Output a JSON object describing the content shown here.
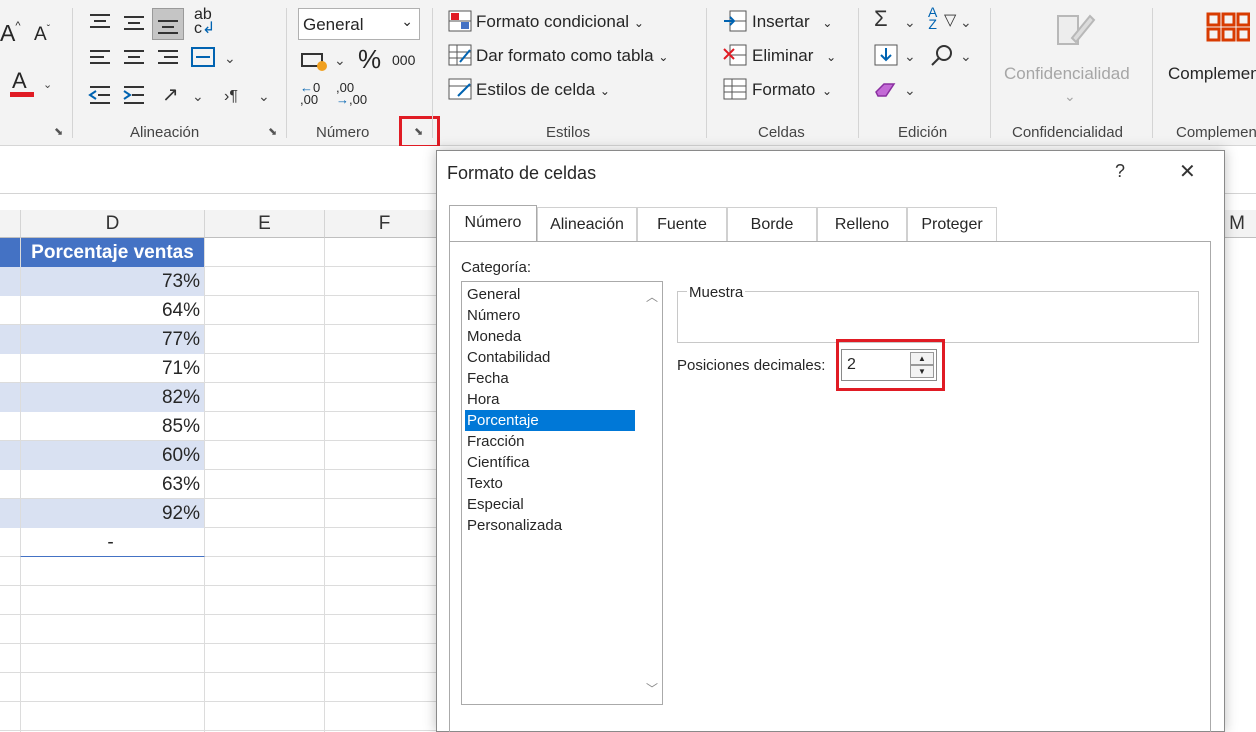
{
  "ribbon": {
    "font_size_up": "A",
    "font_size_down": "A",
    "font_color_letter": "A",
    "wrap_text_label": "ab",
    "wrap_text_label2": "c",
    "number_format_value": "General",
    "thousands_label": "000",
    "percent_label": "%",
    "increase_decimal_label": ",00",
    "decrease_decimal_label": ",00",
    "conditional_format_label": "Formato condicional",
    "format_as_table_label": "Dar formato como tabla",
    "cell_styles_label": "Estilos de celda",
    "insert_label": "Insertar",
    "delete_label": "Eliminar",
    "format_label": "Formato",
    "confidentiality_button_label": "Confidencialidad",
    "complements_button_label": "Complemen",
    "groups": {
      "alignment": "Alineación",
      "number": "Número",
      "styles": "Estilos",
      "cells": "Celdas",
      "editing": "Edición",
      "confidentiality": "Confidencialidad",
      "complements": "Complemen"
    }
  },
  "sheet": {
    "columns": [
      "D",
      "E",
      "F",
      "M"
    ],
    "header_cell": "Porcentaje ventas",
    "values": [
      "73%",
      "64%",
      "77%",
      "71%",
      "82%",
      "85%",
      "60%",
      "63%",
      "92%",
      "-"
    ]
  },
  "dialog": {
    "title": "Formato de celdas",
    "help_label": "?",
    "close_label": "✕",
    "tabs": [
      "Número",
      "Alineación",
      "Fuente",
      "Borde",
      "Relleno",
      "Proteger"
    ],
    "category_label": "Categoría:",
    "categories": [
      "General",
      "Número",
      "Moneda",
      "Contabilidad",
      "Fecha",
      "Hora",
      "Porcentaje",
      "Fracción",
      "Científica",
      "Texto",
      "Especial",
      "Personalizada"
    ],
    "selected_category": "Porcentaje",
    "sample_label": "Muestra",
    "decimal_places_label": "Posiciones decimales:",
    "decimal_places_value": "2"
  },
  "colors": {
    "accent_blue": "#4472c4",
    "band_blue": "#d9e1f2",
    "selection_blue": "#0078d7",
    "highlight_red": "#e01b24"
  }
}
